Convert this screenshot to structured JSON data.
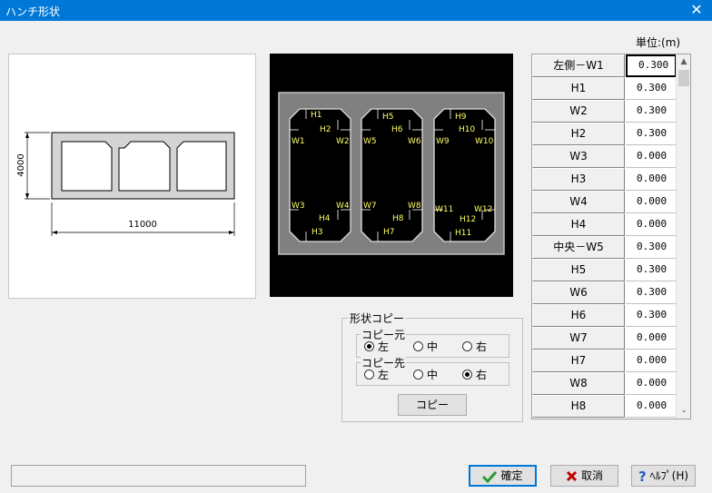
{
  "window": {
    "title": "ハンチ形状",
    "close_glyph": "✕"
  },
  "unit_label": "単位:(m)",
  "overview": {
    "height_dim": "4000",
    "width_dim": "11000"
  },
  "detail": {
    "labels": [
      "H1",
      "W1",
      "H2",
      "W2",
      "W3",
      "H4",
      "W4",
      "H3",
      "H5",
      "W5",
      "H6",
      "W6",
      "W7",
      "H8",
      "W8",
      "H7",
      "H9",
      "W9",
      "H10",
      "W10",
      "W11",
      "H12",
      "W12",
      "H11"
    ]
  },
  "grid": {
    "rows": [
      {
        "label": "左側－W1",
        "value": "0.300"
      },
      {
        "label": "H1",
        "value": "0.300"
      },
      {
        "label": "W2",
        "value": "0.300"
      },
      {
        "label": "H2",
        "value": "0.300"
      },
      {
        "label": "W3",
        "value": "0.000"
      },
      {
        "label": "H3",
        "value": "0.000"
      },
      {
        "label": "W4",
        "value": "0.000"
      },
      {
        "label": "H4",
        "value": "0.000"
      },
      {
        "label": "中央－W5",
        "value": "0.300"
      },
      {
        "label": "H5",
        "value": "0.300"
      },
      {
        "label": "W6",
        "value": "0.300"
      },
      {
        "label": "H6",
        "value": "0.300"
      },
      {
        "label": "W7",
        "value": "0.000"
      },
      {
        "label": "H7",
        "value": "0.000"
      },
      {
        "label": "W8",
        "value": "0.000"
      },
      {
        "label": "H8",
        "value": "0.000"
      }
    ],
    "scroll_up": "▲",
    "scroll_down": "⌄"
  },
  "copy_group": {
    "title": "形状コピー",
    "source": {
      "title": "コピー元",
      "options": [
        "左",
        "中",
        "右"
      ],
      "selected": "左"
    },
    "target": {
      "title": "コピー先",
      "options": [
        "左",
        "中",
        "右"
      ],
      "selected": "右"
    },
    "button": "コピー"
  },
  "footer": {
    "ok": "確定",
    "cancel": "取消",
    "help": "ﾍﾙﾌﾟ(H)",
    "ok_icon": "check-icon",
    "cancel_icon": "x-icon",
    "help_icon": "question-icon",
    "colors": {
      "ok": "#2e9a2e",
      "cancel": "#c00000",
      "help": "#1f5fbf"
    }
  }
}
